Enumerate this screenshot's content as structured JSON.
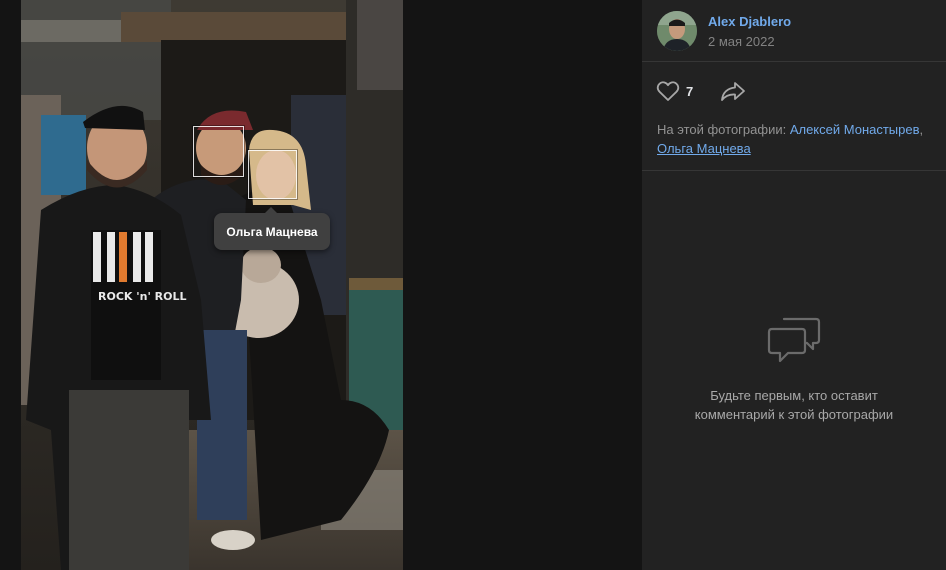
{
  "photo": {
    "alt_icon": "photo",
    "tooltip_name": "Ольга Мацнева",
    "shirt_text": "ROCK 'n' ROLL"
  },
  "author": {
    "name": "Alex Djablero",
    "date": "2 мая 2022",
    "avatar_icon": "user-avatar"
  },
  "actions": {
    "like_icon": "heart-icon",
    "likes": "7",
    "share_icon": "share-icon"
  },
  "tagged": {
    "prefix": "На этой фотографии: ",
    "people": [
      "Алексей Монастырев",
      "Ольга Мацнева"
    ],
    "separator": ","
  },
  "comments": {
    "empty_icon": "comments-icon",
    "empty_line1": "Будьте первым, кто оставит",
    "empty_line2": "комментарий к этой фотографии"
  },
  "colors": {
    "link": "#71aaeb",
    "panel_bg": "#222222",
    "page_bg": "#141414"
  }
}
